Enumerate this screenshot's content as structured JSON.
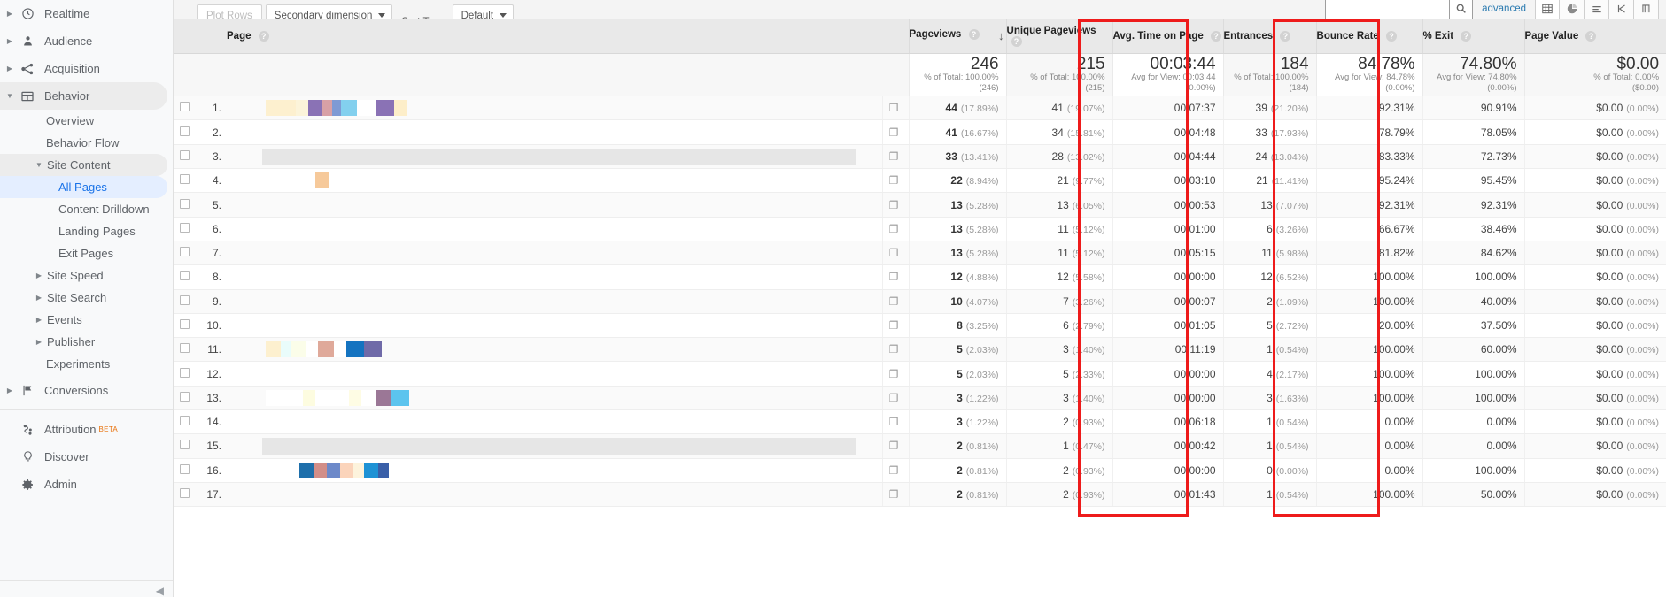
{
  "sidebar": {
    "items": [
      {
        "label": "Realtime",
        "icon": "clock-icon",
        "expandable": true
      },
      {
        "label": "Audience",
        "icon": "person-icon",
        "expandable": true
      },
      {
        "label": "Acquisition",
        "icon": "acquisition-icon",
        "expandable": true
      },
      {
        "label": "Behavior",
        "icon": "behavior-icon",
        "expandable": true,
        "expanded": true
      }
    ],
    "behavior_children": [
      {
        "label": "Overview"
      },
      {
        "label": "Behavior Flow"
      }
    ],
    "site_content": {
      "label": "Site Content"
    },
    "site_content_children": [
      {
        "label": "All Pages",
        "active": true
      },
      {
        "label": "Content Drilldown"
      },
      {
        "label": "Landing Pages"
      },
      {
        "label": "Exit Pages"
      }
    ],
    "behavior_children2": [
      {
        "label": "Site Speed",
        "expandable": true
      },
      {
        "label": "Site Search",
        "expandable": true
      },
      {
        "label": "Events",
        "expandable": true
      },
      {
        "label": "Publisher",
        "expandable": true
      },
      {
        "label": "Experiments",
        "expandable": false
      }
    ],
    "conversions": {
      "label": "Conversions",
      "icon": "flag-icon"
    },
    "bottom": [
      {
        "label": "Attribution",
        "icon": "attribution-icon",
        "badge": "BETA"
      },
      {
        "label": "Discover",
        "icon": "bulb-icon"
      },
      {
        "label": "Admin",
        "icon": "gear-icon"
      }
    ]
  },
  "toolbar": {
    "plot_rows": "Plot Rows",
    "secondary_dimension": "Secondary dimension",
    "sort_type_label": "Sort Type:",
    "sort_type_value": "Default",
    "search_value": "",
    "search_placeholder": "",
    "advanced": "advanced",
    "views": [
      "table-view-icon",
      "pie-view-icon",
      "bar-view-icon",
      "comparison-view-icon",
      "pivot-view-icon"
    ]
  },
  "table": {
    "columns": [
      {
        "key": "page",
        "label": "Page",
        "help": true
      },
      {
        "key": "pageviews",
        "label": "Pageviews",
        "help": true,
        "sorted": true
      },
      {
        "key": "unique_pageviews",
        "label": "Unique Pageviews",
        "help": true
      },
      {
        "key": "avg_time_on_page",
        "label": "Avg. Time on Page",
        "help": true,
        "highlighted": true
      },
      {
        "key": "entrances",
        "label": "Entrances",
        "help": true
      },
      {
        "key": "bounce_rate",
        "label": "Bounce Rate",
        "help": true,
        "highlighted": true
      },
      {
        "key": "pct_exit",
        "label": "% Exit",
        "help": true
      },
      {
        "key": "page_value",
        "label": "Page Value",
        "help": true
      }
    ],
    "summary": {
      "pageviews": {
        "value": "246",
        "line2": "% of Total: 100.00%",
        "line3": "(246)"
      },
      "unique_pageviews": {
        "value": "215",
        "line2": "% of Total: 100.00%",
        "line3": "(215)"
      },
      "avg_time_on_page": {
        "value": "00:03:44",
        "line2": "Avg for View: 00:03:44",
        "line3": "(0.00%)"
      },
      "entrances": {
        "value": "184",
        "line2": "% of Total: 100.00%",
        "line3": "(184)"
      },
      "bounce_rate": {
        "value": "84.78%",
        "line2": "Avg for View: 84.78%",
        "line3": "(0.00%)"
      },
      "pct_exit": {
        "value": "74.80%",
        "line2": "Avg for View: 74.80%",
        "line3": "(0.00%)"
      },
      "page_value": {
        "value": "$0.00",
        "line2": "% of Total: 0.00%",
        "line3": "($0.00)"
      }
    },
    "rows": [
      {
        "index": "1.",
        "pageviews": "44",
        "pageviews_pct": "(17.89%)",
        "unique_pageviews": "41",
        "unique_pageviews_pct": "(19.07%)",
        "avg_time_on_page": "00:07:37",
        "entrances": "39",
        "entrances_pct": "(21.20%)",
        "bounce_rate": "92.31%",
        "pct_exit": "90.91%",
        "page_value": "$0.00",
        "page_value_pct": "(0.00%)",
        "redaction": "swatches-a"
      },
      {
        "index": "2.",
        "pageviews": "41",
        "pageviews_pct": "(16.67%)",
        "unique_pageviews": "34",
        "unique_pageviews_pct": "(15.81%)",
        "avg_time_on_page": "00:04:48",
        "entrances": "33",
        "entrances_pct": "(17.93%)",
        "bounce_rate": "78.79%",
        "pct_exit": "78.05%",
        "page_value": "$0.00",
        "page_value_pct": "(0.00%)",
        "redaction": "none"
      },
      {
        "index": "3.",
        "pageviews": "33",
        "pageviews_pct": "(13.41%)",
        "unique_pageviews": "28",
        "unique_pageviews_pct": "(13.02%)",
        "avg_time_on_page": "00:04:44",
        "entrances": "24",
        "entrances_pct": "(13.04%)",
        "bounce_rate": "83.33%",
        "pct_exit": "72.73%",
        "page_value": "$0.00",
        "page_value_pct": "(0.00%)",
        "redaction": "greybar"
      },
      {
        "index": "4.",
        "pageviews": "22",
        "pageviews_pct": "(8.94%)",
        "unique_pageviews": "21",
        "unique_pageviews_pct": "(9.77%)",
        "avg_time_on_page": "00:03:10",
        "entrances": "21",
        "entrances_pct": "(11.41%)",
        "bounce_rate": "95.24%",
        "pct_exit": "95.45%",
        "page_value": "$0.00",
        "page_value_pct": "(0.00%)",
        "redaction": "swatches-b"
      },
      {
        "index": "5.",
        "pageviews": "13",
        "pageviews_pct": "(5.28%)",
        "unique_pageviews": "13",
        "unique_pageviews_pct": "(6.05%)",
        "avg_time_on_page": "00:00:53",
        "entrances": "13",
        "entrances_pct": "(7.07%)",
        "bounce_rate": "92.31%",
        "pct_exit": "92.31%",
        "page_value": "$0.00",
        "page_value_pct": "(0.00%)",
        "redaction": "none"
      },
      {
        "index": "6.",
        "pageviews": "13",
        "pageviews_pct": "(5.28%)",
        "unique_pageviews": "11",
        "unique_pageviews_pct": "(5.12%)",
        "avg_time_on_page": "00:01:00",
        "entrances": "6",
        "entrances_pct": "(3.26%)",
        "bounce_rate": "66.67%",
        "pct_exit": "38.46%",
        "page_value": "$0.00",
        "page_value_pct": "(0.00%)",
        "redaction": "none"
      },
      {
        "index": "7.",
        "pageviews": "13",
        "pageviews_pct": "(5.28%)",
        "unique_pageviews": "11",
        "unique_pageviews_pct": "(5.12%)",
        "avg_time_on_page": "00:05:15",
        "entrances": "11",
        "entrances_pct": "(5.98%)",
        "bounce_rate": "81.82%",
        "pct_exit": "84.62%",
        "page_value": "$0.00",
        "page_value_pct": "(0.00%)",
        "redaction": "none"
      },
      {
        "index": "8.",
        "pageviews": "12",
        "pageviews_pct": "(4.88%)",
        "unique_pageviews": "12",
        "unique_pageviews_pct": "(5.58%)",
        "avg_time_on_page": "00:00:00",
        "entrances": "12",
        "entrances_pct": "(6.52%)",
        "bounce_rate": "100.00%",
        "pct_exit": "100.00%",
        "page_value": "$0.00",
        "page_value_pct": "(0.00%)",
        "redaction": "none"
      },
      {
        "index": "9.",
        "pageviews": "10",
        "pageviews_pct": "(4.07%)",
        "unique_pageviews": "7",
        "unique_pageviews_pct": "(3.26%)",
        "avg_time_on_page": "00:00:07",
        "entrances": "2",
        "entrances_pct": "(1.09%)",
        "bounce_rate": "100.00%",
        "pct_exit": "40.00%",
        "page_value": "$0.00",
        "page_value_pct": "(0.00%)",
        "redaction": "none"
      },
      {
        "index": "10.",
        "pageviews": "8",
        "pageviews_pct": "(3.25%)",
        "unique_pageviews": "6",
        "unique_pageviews_pct": "(2.79%)",
        "avg_time_on_page": "00:01:05",
        "entrances": "5",
        "entrances_pct": "(2.72%)",
        "bounce_rate": "20.00%",
        "pct_exit": "37.50%",
        "page_value": "$0.00",
        "page_value_pct": "(0.00%)",
        "redaction": "none"
      },
      {
        "index": "11.",
        "pageviews": "5",
        "pageviews_pct": "(2.03%)",
        "unique_pageviews": "3",
        "unique_pageviews_pct": "(1.40%)",
        "avg_time_on_page": "00:11:19",
        "entrances": "1",
        "entrances_pct": "(0.54%)",
        "bounce_rate": "100.00%",
        "pct_exit": "60.00%",
        "page_value": "$0.00",
        "page_value_pct": "(0.00%)",
        "redaction": "swatches-c"
      },
      {
        "index": "12.",
        "pageviews": "5",
        "pageviews_pct": "(2.03%)",
        "unique_pageviews": "5",
        "unique_pageviews_pct": "(2.33%)",
        "avg_time_on_page": "00:00:00",
        "entrances": "4",
        "entrances_pct": "(2.17%)",
        "bounce_rate": "100.00%",
        "pct_exit": "100.00%",
        "page_value": "$0.00",
        "page_value_pct": "(0.00%)",
        "redaction": "none"
      },
      {
        "index": "13.",
        "pageviews": "3",
        "pageviews_pct": "(1.22%)",
        "unique_pageviews": "3",
        "unique_pageviews_pct": "(1.40%)",
        "avg_time_on_page": "00:00:00",
        "entrances": "3",
        "entrances_pct": "(1.63%)",
        "bounce_rate": "100.00%",
        "pct_exit": "100.00%",
        "page_value": "$0.00",
        "page_value_pct": "(0.00%)",
        "redaction": "swatches-d"
      },
      {
        "index": "14.",
        "pageviews": "3",
        "pageviews_pct": "(1.22%)",
        "unique_pageviews": "2",
        "unique_pageviews_pct": "(0.93%)",
        "avg_time_on_page": "00:06:18",
        "entrances": "1",
        "entrances_pct": "(0.54%)",
        "bounce_rate": "0.00%",
        "pct_exit": "0.00%",
        "page_value": "$0.00",
        "page_value_pct": "(0.00%)",
        "redaction": "none"
      },
      {
        "index": "15.",
        "pageviews": "2",
        "pageviews_pct": "(0.81%)",
        "unique_pageviews": "1",
        "unique_pageviews_pct": "(0.47%)",
        "avg_time_on_page": "00:00:42",
        "entrances": "1",
        "entrances_pct": "(0.54%)",
        "bounce_rate": "0.00%",
        "pct_exit": "0.00%",
        "page_value": "$0.00",
        "page_value_pct": "(0.00%)",
        "redaction": "greybar"
      },
      {
        "index": "16.",
        "pageviews": "2",
        "pageviews_pct": "(0.81%)",
        "unique_pageviews": "2",
        "unique_pageviews_pct": "(0.93%)",
        "avg_time_on_page": "00:00:00",
        "entrances": "0",
        "entrances_pct": "(0.00%)",
        "bounce_rate": "0.00%",
        "pct_exit": "100.00%",
        "page_value": "$0.00",
        "page_value_pct": "(0.00%)",
        "redaction": "swatches-e"
      },
      {
        "index": "17.",
        "pageviews": "2",
        "pageviews_pct": "(0.81%)",
        "unique_pageviews": "2",
        "unique_pageviews_pct": "(0.93%)",
        "avg_time_on_page": "00:01:43",
        "entrances": "1",
        "entrances_pct": "(0.54%)",
        "bounce_rate": "100.00%",
        "pct_exit": "50.00%",
        "page_value": "$0.00",
        "page_value_pct": "(0.00%)",
        "redaction": "none"
      }
    ]
  },
  "colors": {
    "highlight": "#ee1b1b",
    "link": "#1a73e8",
    "beta": "#e8710a"
  }
}
